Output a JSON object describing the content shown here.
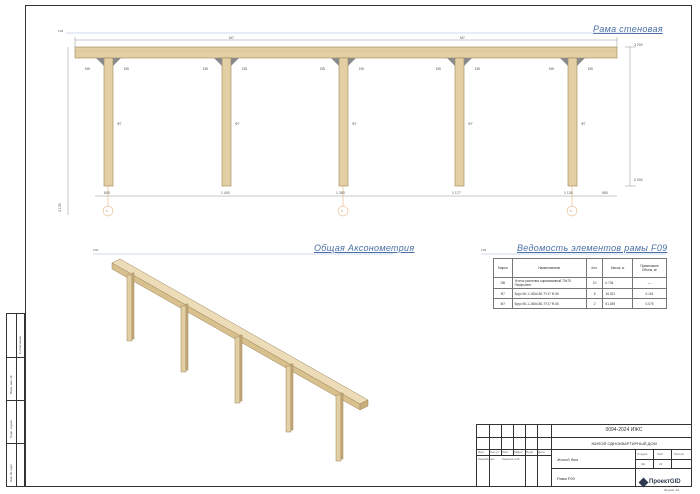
{
  "frame_title": "Рама стеновая",
  "axon_title": "Общая Аксонометрия",
  "spec_title": "Ведомость элементов рамы F09",
  "frame_tag": "F09",
  "spec_tag": "F09",
  "axon_tag": "F09",
  "dims": {
    "top_left": "M7",
    "top_right": "M7",
    "right_top": "3 200",
    "right_bottom": "0 000",
    "overall_height": "3 130",
    "posts": [
      "Ф7",
      "Ф7",
      "Ф7",
      "Ф7",
      "Ф7"
    ],
    "braces": [
      "DB",
      "DB",
      "DB",
      "DB",
      "DB",
      "DB",
      "DB",
      "DB",
      "DB",
      "DB"
    ],
    "bottom_spans": [
      "600",
      "1 400",
      "1 353",
      "1 177",
      "1 130",
      "550"
    ],
    "axes": [
      "3",
      "4",
      "5"
    ]
  },
  "spec": {
    "headers": [
      "Марка",
      "Наименование",
      "Кол.",
      "Масса, кг",
      "Примечание Объем, м³"
    ],
    "rows": [
      [
        "DB",
        "Уголок усиления оцинкованный 75x75 Перфолент",
        "10",
        "0.734",
        "—"
      ],
      [
        "Ф7",
        "Брус КК-1-150x150-ТУ17 Ф-06",
        "5",
        "16.321",
        "0.161"
      ],
      [
        "M7",
        "Брус КК-1-150x150-ТУ17 Ф-06",
        "2",
        "51.049",
        "0.075"
      ]
    ]
  },
  "stamp": {
    "code": "0094-2024 ИЖС",
    "project": "ЖИЛОЙ ОДНОКВАРТИРНЫЙ ДОМ",
    "building": "Жилой дом",
    "sheet_name": "Рама F09",
    "stage_label": "Стадия",
    "sheet_label": "Лист",
    "sheets_label": "Листов",
    "stage": "КД",
    "sheet": "22",
    "sheets": "",
    "row_headers": [
      "Изм.",
      "Кол.уч.",
      "Лист",
      "№Док.",
      "Подп.",
      "Дата"
    ],
    "developer_label": "Разработал",
    "developer": "Ковалев А.В.",
    "logo": "ПроектGID",
    "format": "Формат А3"
  },
  "side": {
    "labels": [
      "Согласовано",
      "Взам. инв. №",
      "Подп. и дата",
      "Инв. № подл."
    ]
  },
  "colors": {
    "wood": "#e3cfa4",
    "wood_dark": "#c8ad7c",
    "wood_edge": "#9c8559",
    "accent": "#4a6fa5"
  }
}
